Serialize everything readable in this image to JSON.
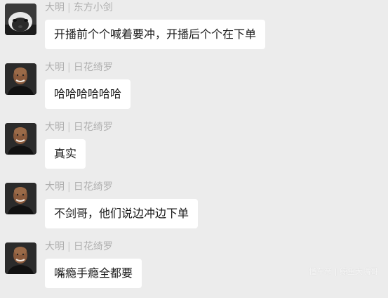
{
  "messages": [
    {
      "sender": "大明",
      "group": "东方小剑",
      "text": "开播前个个喊着要冲，开播后个个在下单",
      "avatar": "raccoon-avatar"
    },
    {
      "sender": "大明",
      "group": "日花绮罗",
      "text": "哈哈哈哈哈哈",
      "avatar": "bald-man-avatar"
    },
    {
      "sender": "大明",
      "group": "日花绮罗",
      "text": "真实",
      "avatar": "bald-man-avatar"
    },
    {
      "sender": "大明",
      "group": "日花绮罗",
      "text": "不剑哥，他们说边冲边下单",
      "avatar": "bald-man-avatar"
    },
    {
      "sender": "大明",
      "group": "日花绮罗",
      "text": "嘴瘾手瘾全都要",
      "avatar": "bald-man-avatar"
    }
  ],
  "separator": "|",
  "watermark": "懂车帝 | 鲸鱼大嘴哥",
  "colors": {
    "background": "#ececec",
    "bubble": "#ffffff",
    "name_text": "#b0b0b0",
    "message_text": "#1a1a1a"
  }
}
